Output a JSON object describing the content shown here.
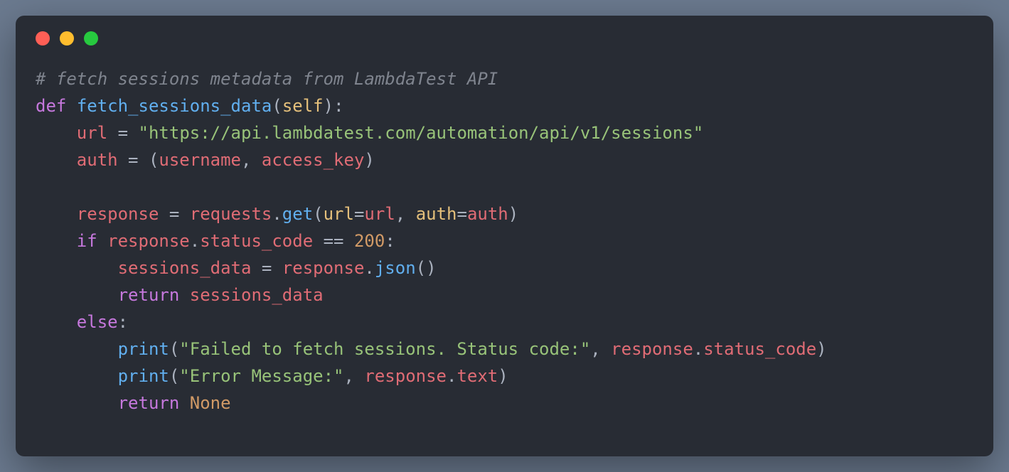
{
  "titlebar": {
    "buttons": [
      "close",
      "minimize",
      "zoom"
    ]
  },
  "colors": {
    "background": "#282c34",
    "comment": "#7f848e",
    "keyword": "#c678dd",
    "function": "#61afef",
    "string": "#98c379",
    "number": "#d19a66",
    "variable": "#e06c75",
    "param": "#e5c07b",
    "foreground": "#abb2bf"
  },
  "code": {
    "comment": "# fetch sessions metadata from LambdaTest API",
    "kw_def": "def",
    "fn_name": "fetch_sessions_data",
    "param_self": "self",
    "var_url": "url",
    "op_assign": "=",
    "str_url": "\"https://api.lambdatest.com/automation/api/v1/sessions\"",
    "var_auth": "auth",
    "id_username": "username",
    "id_access_key": "access_key",
    "var_response": "response",
    "id_requests": "requests",
    "fn_get": "get",
    "kw_url": "url",
    "kw_auth": "auth",
    "kw_if": "if",
    "attr_status_code": "status_code",
    "op_eq": "==",
    "num_200": "200",
    "var_sessions_data": "sessions_data",
    "fn_json": "json",
    "kw_return": "return",
    "kw_else": "else",
    "fn_print": "print",
    "str_fail": "\"Failed to fetch sessions. Status code:\"",
    "str_err": "\"Error Message:\"",
    "attr_text": "text",
    "const_none": "None",
    "indent1": "    ",
    "indent2": "        ",
    "punc_lparen": "(",
    "punc_rparen": ")",
    "punc_colon": ":",
    "punc_comma": ",",
    "punc_dot": "."
  }
}
